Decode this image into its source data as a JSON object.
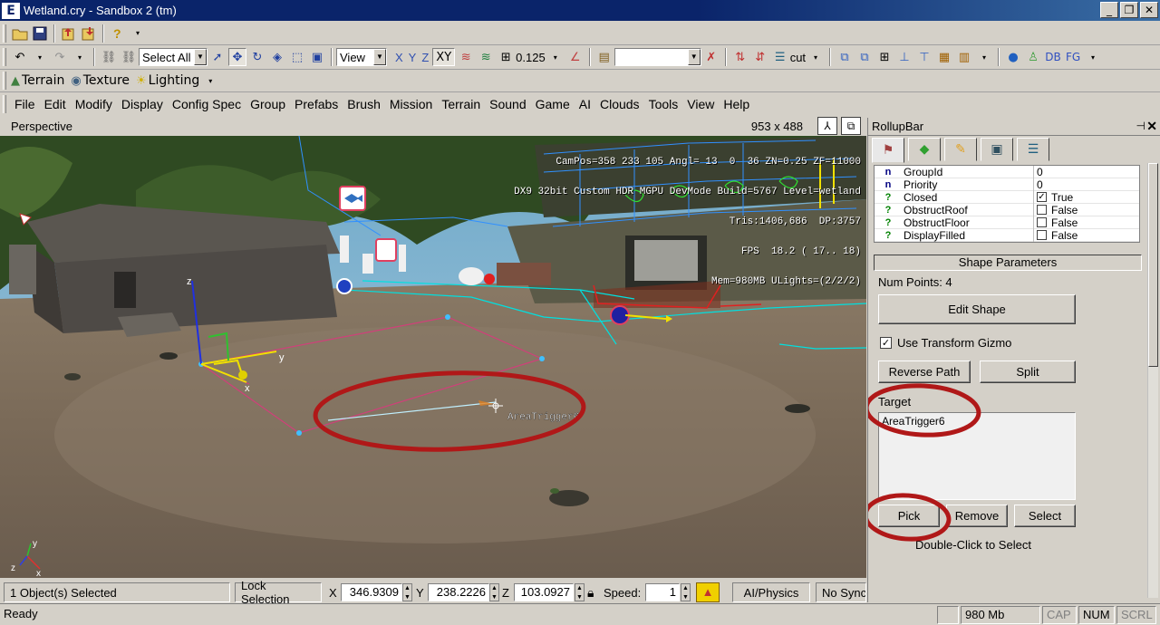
{
  "window": {
    "app_icon": "E",
    "title": "Wetland.cry - Sandbox 2 (tm)",
    "min_glyph": "_",
    "max_glyph": "❐",
    "close_glyph": "✕"
  },
  "toolbar1": {
    "icons": [
      "open-icon",
      "save-icon",
      "export-icon",
      "import-icon",
      "help-icon"
    ]
  },
  "toolbar2": {
    "select_all": "Select All",
    "view_combo": "View",
    "axis_x": "X",
    "axis_y": "Y",
    "axis_z": "Z",
    "axis_xy": "XY",
    "grid_value": "0.125",
    "layer_combo": "",
    "layer_label": "cut",
    "db_label": "DB",
    "fg_label": "FG"
  },
  "toolbar3": {
    "terrain": "Terrain",
    "texture": "Texture",
    "lighting": "Lighting"
  },
  "menu": {
    "items": [
      "File",
      "Edit",
      "Modify",
      "Display",
      "Config Spec",
      "Group",
      "Prefabs",
      "Brush",
      "Mission",
      "Terrain",
      "Sound",
      "Game",
      "AI",
      "Clouds",
      "Tools",
      "View",
      "Help"
    ]
  },
  "viewport": {
    "title": "Perspective",
    "size": "953 x 488",
    "overlay_lines": [
      "CamPos=358 233 105 Angl= 13  0  36 ZN=0.25 ZF=11000",
      "DX9 32bit Custom HDR MGPU DevMode Build=5767 Level=wetland",
      "Tris:1406,686  DP:3757",
      "FPS  18.2 ( 17.. 18)",
      "Mem=980MB ULights=(2/2/2)"
    ],
    "object_label": "AreaTrigger6",
    "gizmo_x": "x",
    "gizmo_y": "y",
    "gizmo_z": "z"
  },
  "rollup": {
    "title": "RollupBar",
    "pin": "⊣",
    "close": "✕",
    "properties": [
      {
        "icon": "n",
        "name": "GroupId",
        "value": "0",
        "checkbox": null
      },
      {
        "icon": "n",
        "name": "Priority",
        "value": "0",
        "checkbox": null
      },
      {
        "icon": "?",
        "name": "Closed",
        "value": "True",
        "checkbox": true
      },
      {
        "icon": "?",
        "name": "ObstructRoof",
        "value": "False",
        "checkbox": false
      },
      {
        "icon": "?",
        "name": "ObstructFloor",
        "value": "False",
        "checkbox": false
      },
      {
        "icon": "?",
        "name": "DisplayFilled",
        "value": "False",
        "checkbox": false
      }
    ],
    "shape_params_header": "Shape Parameters",
    "num_points": "Num Points: 4",
    "edit_shape": "Edit Shape",
    "use_gizmo": "Use Transform Gizmo",
    "use_gizmo_checked": true,
    "reverse_path": "Reverse Path",
    "split": "Split",
    "target_label": "Target",
    "target_value": "AreaTrigger6",
    "pick": "Pick",
    "remove": "Remove",
    "select": "Select",
    "hint": "Double-Click to Select"
  },
  "statusbar": {
    "selected": "1 Object(s) Selected",
    "lock_selection": "Lock Selection",
    "x_label": "X",
    "x_value": "346.9309",
    "y_label": "Y",
    "y_value": "238.2226",
    "z_label": "Z",
    "z_value": "103.0927",
    "speed_label": "Speed:",
    "speed_value": "1",
    "ai_physics": "AI/Physics",
    "no_sync": "No Sync",
    "ready": "Ready",
    "memory": "980 Mb",
    "cap": "CAP",
    "num": "NUM",
    "scrl": "SCRL"
  },
  "colors": {
    "titlebar": "#0a246a",
    "annotation_red": "#b01818",
    "shape_magenta": "#d0407a",
    "gizmo_yellow": "#f0e000"
  }
}
